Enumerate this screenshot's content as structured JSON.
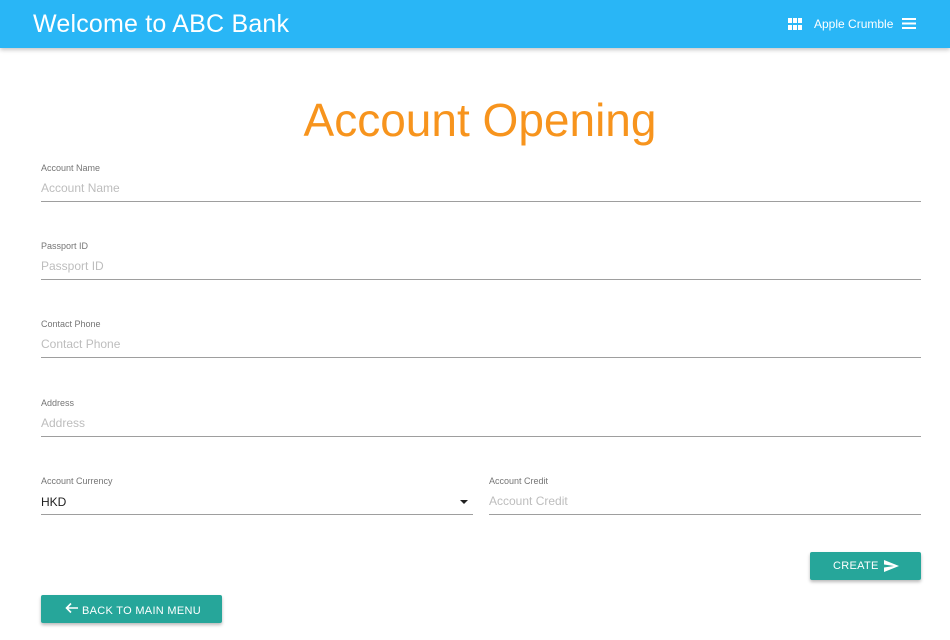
{
  "header": {
    "title": "Welcome to ABC Bank",
    "user_name": "Apple Crumble",
    "grid_icon": "grid-icon",
    "menu_icon": "hamburger-menu-icon",
    "background_color": "#29b6f6"
  },
  "page": {
    "title": "Account Opening",
    "title_color": "#f7941d"
  },
  "form": {
    "account_name": {
      "label": "Account Name",
      "placeholder": "Account Name",
      "value": ""
    },
    "passport_id": {
      "label": "Passport ID",
      "placeholder": "Passport ID",
      "value": ""
    },
    "contact_phone": {
      "label": "Contact Phone",
      "placeholder": "Contact Phone",
      "value": ""
    },
    "address": {
      "label": "Address",
      "placeholder": "Address",
      "value": ""
    },
    "account_currency": {
      "label": "Account Currency",
      "selected": "HKD"
    },
    "account_credit": {
      "label": "Account Credit",
      "placeholder": "Account Credit",
      "value": ""
    }
  },
  "actions": {
    "create_label": "CREATE",
    "create_icon": "send-icon",
    "back_label": "BACK TO MAIN MENU",
    "back_icon": "arrow-left-icon",
    "button_color": "#26a69a"
  }
}
